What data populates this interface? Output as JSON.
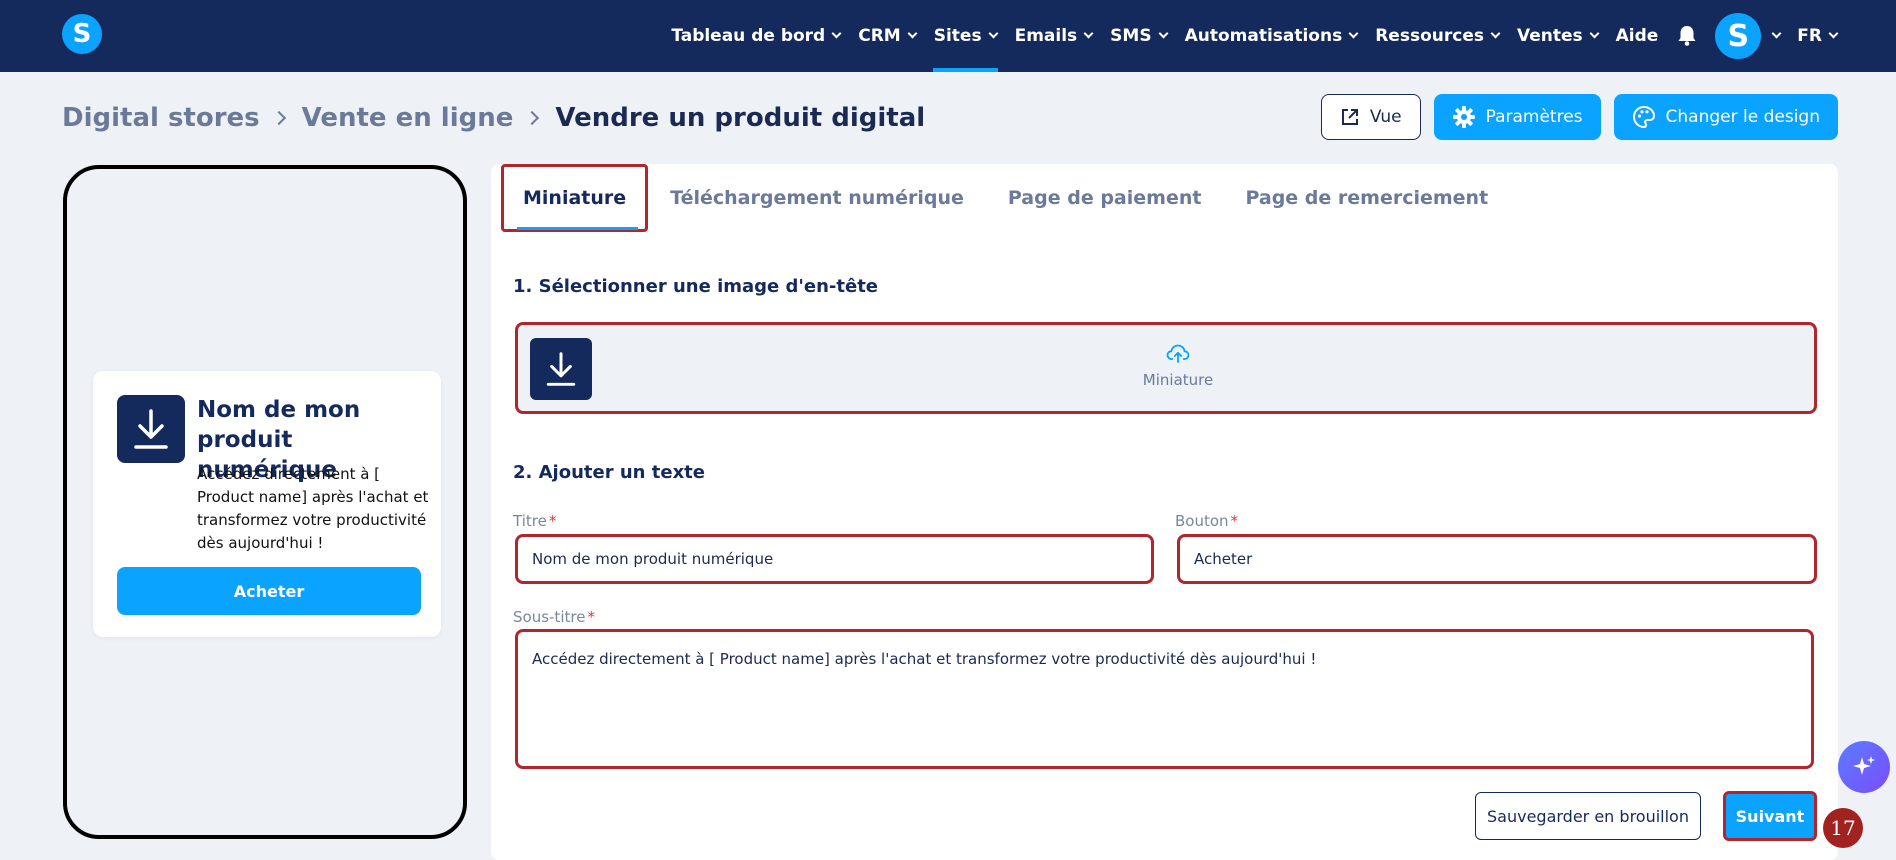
{
  "nav": {
    "items": [
      {
        "label": "Tableau de bord",
        "dropdown": true,
        "active": false
      },
      {
        "label": "CRM",
        "dropdown": true,
        "active": false
      },
      {
        "label": "Sites",
        "dropdown": true,
        "active": true
      },
      {
        "label": "Emails",
        "dropdown": true,
        "active": false
      },
      {
        "label": "SMS",
        "dropdown": true,
        "active": false
      },
      {
        "label": "Automatisations",
        "dropdown": true,
        "active": false
      },
      {
        "label": "Ressources",
        "dropdown": true,
        "active": false
      },
      {
        "label": "Ventes",
        "dropdown": true,
        "active": false
      },
      {
        "label": "Aide",
        "dropdown": false,
        "active": false
      }
    ],
    "avatar_letter": "S",
    "logo_letter": "S",
    "language": "FR"
  },
  "breadcrumb": {
    "items": [
      "Digital stores",
      "Vente en ligne"
    ],
    "current": "Vendre un produit digital"
  },
  "actions": {
    "view_label": "Vue",
    "settings_label": "Paramètres",
    "design_label": "Changer le design"
  },
  "preview": {
    "title": "Nom de mon produit numérique",
    "subtitle": "Accédez directement à [ Product name] après l'achat et transformez votre productivité dès aujourd'hui !",
    "button": "Acheter"
  },
  "tabs": [
    "Miniature",
    "Téléchargement numérique",
    "Page de paiement",
    "Page de remerciement"
  ],
  "form": {
    "section1": "1. Sélectionner une image d'en-tête",
    "upload_label": "Miniature",
    "section2": "2. Ajouter un texte",
    "title_label": "Titre",
    "title_value": "Nom de mon produit numérique",
    "button_label": "Bouton",
    "button_value": "Acheter",
    "subtitle_label": "Sous-titre",
    "subtitle_value": "Accédez directement à [ Product name] après l'achat et transformez votre productivité dès aujourd'hui !",
    "required_mark": "*"
  },
  "footer": {
    "draft_label": "Sauvegarder en brouillon",
    "next_label": "Suivant"
  },
  "step_number": "17",
  "colors": {
    "navbar": "#152a5c",
    "accent": "#0aa3ff",
    "highlight": "#b1262d"
  }
}
